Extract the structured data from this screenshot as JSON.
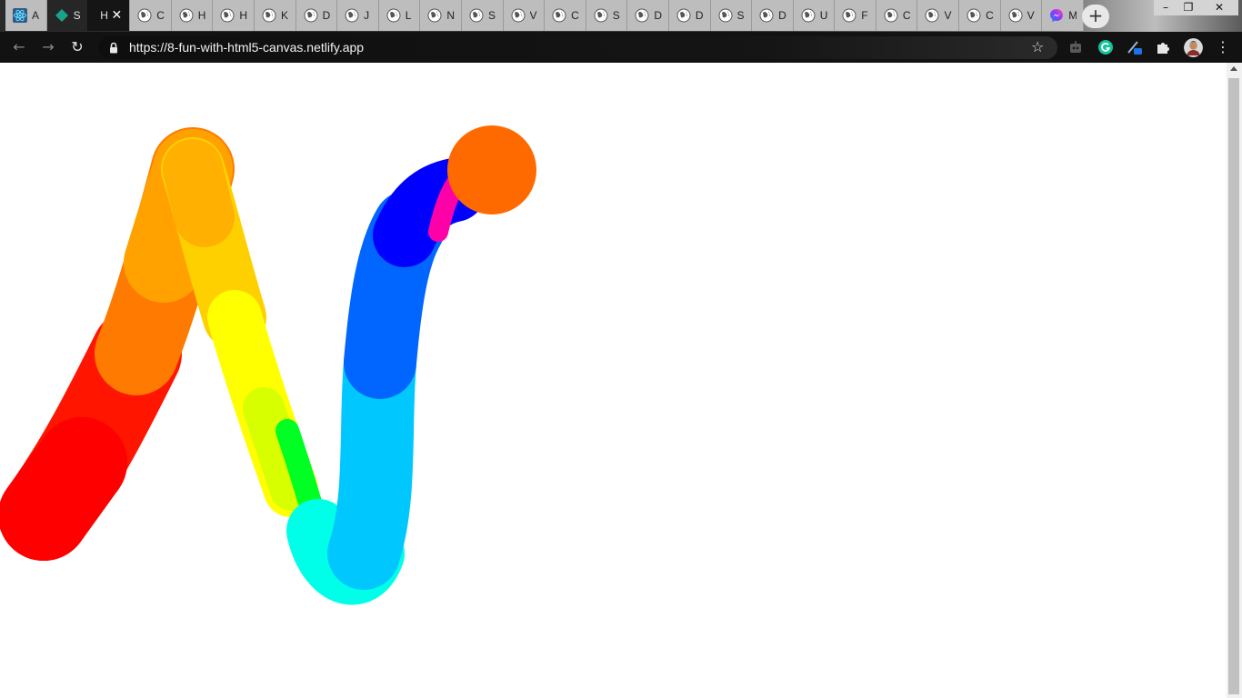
{
  "browser": {
    "tabs": [
      {
        "title": "A",
        "favicon": "react-icon",
        "active": false
      },
      {
        "title": "S",
        "favicon": "diamond-icon",
        "active": false
      },
      {
        "title": "H",
        "favicon": "none",
        "active": true
      },
      {
        "title": "C",
        "favicon": "globe-icon",
        "active": false
      },
      {
        "title": "H",
        "favicon": "globe-icon",
        "active": false
      },
      {
        "title": "H",
        "favicon": "globe-icon",
        "active": false
      },
      {
        "title": "K",
        "favicon": "globe-icon",
        "active": false
      },
      {
        "title": "D",
        "favicon": "globe-icon",
        "active": false
      },
      {
        "title": "J",
        "favicon": "globe-icon",
        "active": false
      },
      {
        "title": "L",
        "favicon": "globe-icon",
        "active": false
      },
      {
        "title": "N",
        "favicon": "globe-icon",
        "active": false
      },
      {
        "title": "S",
        "favicon": "globe-icon",
        "active": false
      },
      {
        "title": "V",
        "favicon": "globe-icon",
        "active": false
      },
      {
        "title": "C",
        "favicon": "globe-icon",
        "active": false
      },
      {
        "title": "S",
        "favicon": "globe-icon",
        "active": false
      },
      {
        "title": "D",
        "favicon": "globe-icon",
        "active": false
      },
      {
        "title": "D",
        "favicon": "globe-icon",
        "active": false
      },
      {
        "title": "S",
        "favicon": "globe-icon",
        "active": false
      },
      {
        "title": "D",
        "favicon": "globe-icon",
        "active": false
      },
      {
        "title": "U",
        "favicon": "globe-icon",
        "active": false
      },
      {
        "title": "F",
        "favicon": "globe-icon",
        "active": false
      },
      {
        "title": "C",
        "favicon": "globe-icon",
        "active": false
      },
      {
        "title": "V",
        "favicon": "globe-icon",
        "active": false
      },
      {
        "title": "C",
        "favicon": "globe-icon",
        "active": false
      },
      {
        "title": "V",
        "favicon": "globe-icon",
        "active": false
      },
      {
        "title": "M",
        "favicon": "messenger-icon",
        "active": false
      }
    ],
    "active_tab_close": "✕",
    "new_tab_symbol": "+",
    "window_controls": {
      "minimize": "–",
      "restore": "❐",
      "close": "✕"
    },
    "nav": {
      "back": "←",
      "forward": "→",
      "reload": "↻"
    },
    "url": "https://8-fun-with-html5-canvas.netlify.app",
    "bookmark_star": "☆",
    "extensions": [
      "robot-icon",
      "grammarly-icon",
      "pen-icon",
      "puzzle-icon"
    ],
    "menu": "⋮"
  },
  "canvas": {
    "stroke": "rainbow hue-cycling line, round caps",
    "colors": {
      "background": "#ffffff",
      "start_red": "#ff0000",
      "orange": "#ff6600",
      "yellow": "#ffff00",
      "green": "#00ff22",
      "cyan": "#00ffee",
      "blue": "#0000ff",
      "magenta": "#ff00aa",
      "end_orange": "#ff6a00"
    }
  },
  "colors": {
    "tabstrip": "#2b2b2b",
    "toolbar": "#121212",
    "url_text": "#f2f2f2",
    "grammarly": "#15c39a",
    "scrollbar_thumb": "#c1c1c1"
  }
}
